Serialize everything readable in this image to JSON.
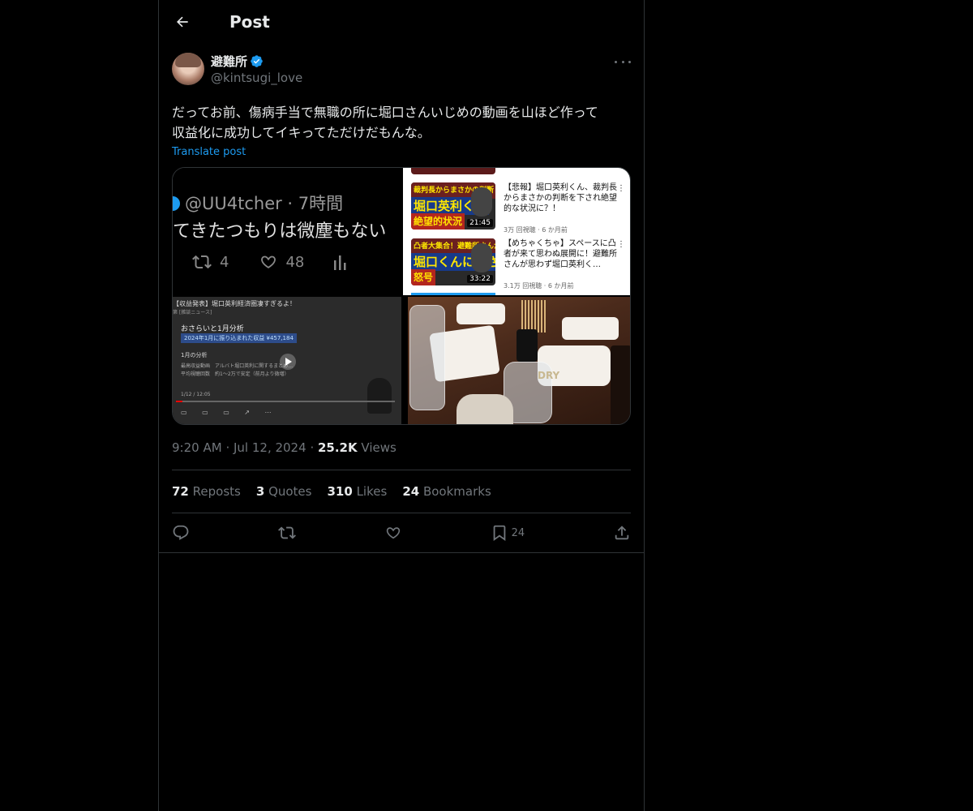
{
  "header": {
    "title": "Post"
  },
  "author": {
    "display_name": "避難所",
    "handle": "@kintsugi_love"
  },
  "post": {
    "text_line1": "だってお前、傷病手当で無職の所に堀口さんいじめの動画を山ほど作って",
    "text_line2": "収益化に成功してイキってただけだもんな。",
    "translate_label": "Translate post"
  },
  "media": {
    "tile1": {
      "handle": "@UU4tcher · 7時間",
      "text": "てきたつもりは微塵もない",
      "reposts": "4",
      "likes": "48"
    },
    "tile2": {
      "videos": [
        {
          "thumb_top": "裁判長からまさかの判断",
          "thumb_mid": "堀口英利くん",
          "thumb_bot": "絶望的状況",
          "duration": "21:45",
          "title": "【悲報】堀口英利くん、裁判長からまさかの判断を下され絶望的な状況に？！",
          "meta": "3万 回視聴 · 6 か月前"
        },
        {
          "thumb_top": "凸者大集合！避難所さんが",
          "thumb_mid": "堀口くんにまさかの",
          "thumb_bot": "怒号",
          "duration": "33:22",
          "title": "【めちゃくちゃ】スペースに凸者が来て思わぬ展開に！避難所さんが思わず堀口英利く…",
          "meta": "3.1万 回視聴 · 6 か月前"
        }
      ]
    },
    "tile3": {
      "title": "【収益発表】堀口英利経済圏凄すぎるよ！",
      "subtitle": "第 [雑談ニュース]",
      "heading": "おさらいと1月分析",
      "highlight": "2024年1月に振り込まれた収益 ¥457,184",
      "heading2": "1月の分析",
      "line1": "最高収益動画　アルバト堀口英利に関するまとめ…",
      "line2": "平均視聴回数　約1〜2万で安定（前月より微増）",
      "line3": "1/12 / 12:05"
    },
    "tile4": {
      "glass_label": "DRY"
    }
  },
  "meta": {
    "time": "9:20 AM",
    "date": "Jul 12, 2024",
    "views_count": "25.2K",
    "views_label": "Views"
  },
  "stats": {
    "reposts_count": "72",
    "reposts_label": "Reposts",
    "quotes_count": "3",
    "quotes_label": "Quotes",
    "likes_count": "310",
    "likes_label": "Likes",
    "bookmarks_count": "24",
    "bookmarks_label": "Bookmarks"
  },
  "actions": {
    "bookmark_count": "24"
  },
  "colors": {
    "accent": "#1d9bf0",
    "text": "#e7e9ea",
    "muted": "#71767b",
    "border": "#2f3336"
  }
}
